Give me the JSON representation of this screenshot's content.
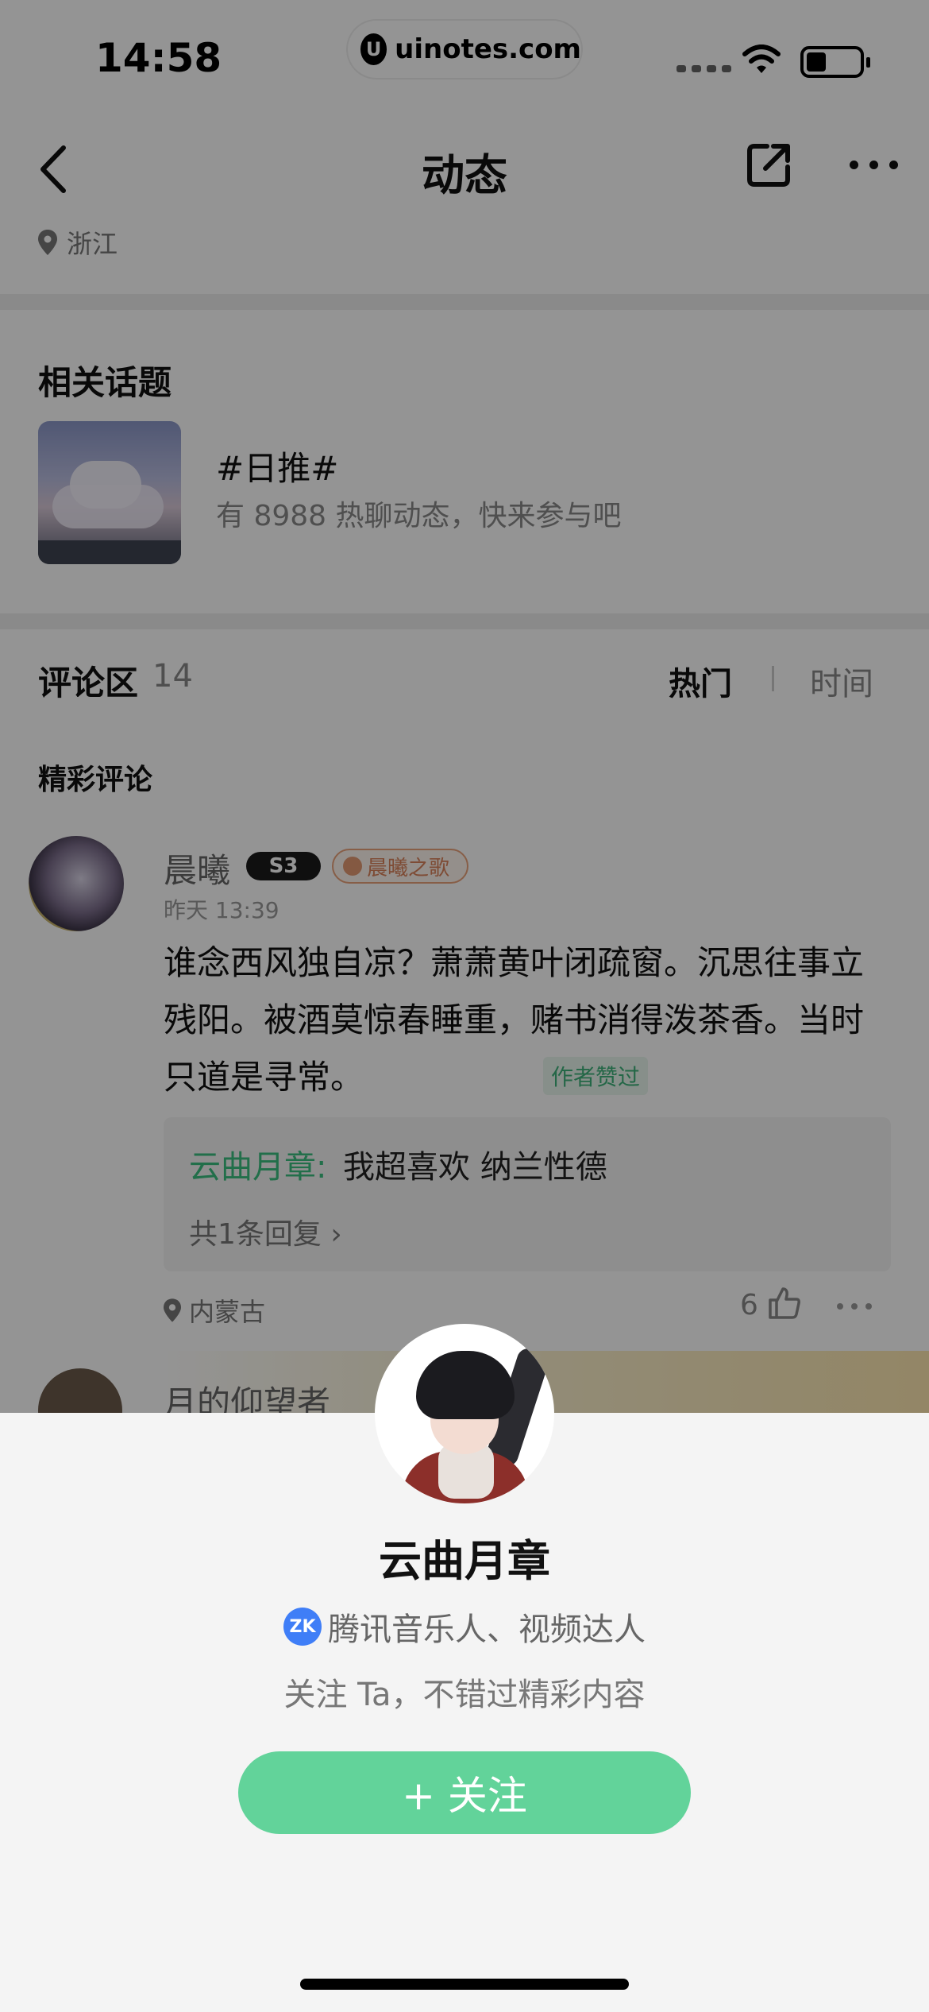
{
  "status_bar": {
    "time": "14:58",
    "url": "uinotes.com",
    "url_logo": "U"
  },
  "nav": {
    "title": "动态",
    "back_icon": "chevron-left-icon",
    "share_icon": "share-out-icon",
    "more_icon": "more-dots-icon"
  },
  "post": {
    "location": "浙江"
  },
  "topics": {
    "heading": "相关话题",
    "items": [
      {
        "name": "#日推#",
        "desc": "有 8988 热聊动态，快来参与吧"
      }
    ]
  },
  "comments": {
    "heading": "评论区",
    "count": "14",
    "sort_hot": "热门",
    "sort_time": "时间",
    "featured_heading": "精彩评论",
    "items": [
      {
        "user": "晨曦",
        "level_badge": "S3",
        "title_badge": "晨曦之歌",
        "time": "昨天 13:39",
        "text": "谁念西风独自凉？萧萧黄叶闭疏窗。沉思往事立残阳。被酒莫惊春睡重，赌书消得泼茶香。当时只道是寻常。",
        "author_liked": "作者赞过",
        "reply": {
          "user": "云曲月章:",
          "text": "我超喜欢 纳兰性德",
          "more": "共1条回复 ›"
        },
        "location": "内蒙古",
        "likes": "6"
      },
      {
        "user": "月的仰望者"
      }
    ]
  },
  "sheet": {
    "name": "云曲月章",
    "auth_icon_text": "ZK",
    "auth_text": "腾讯音乐人、视频达人",
    "hint": "关注 Ta，不错过精彩内容",
    "follow_label": "+ 关注"
  },
  "colors": {
    "accent_green": "#62d39a",
    "reply_user_green": "#3cbf80",
    "badge_orange": "#d9825a",
    "auth_blue": "#3f7ef7"
  }
}
